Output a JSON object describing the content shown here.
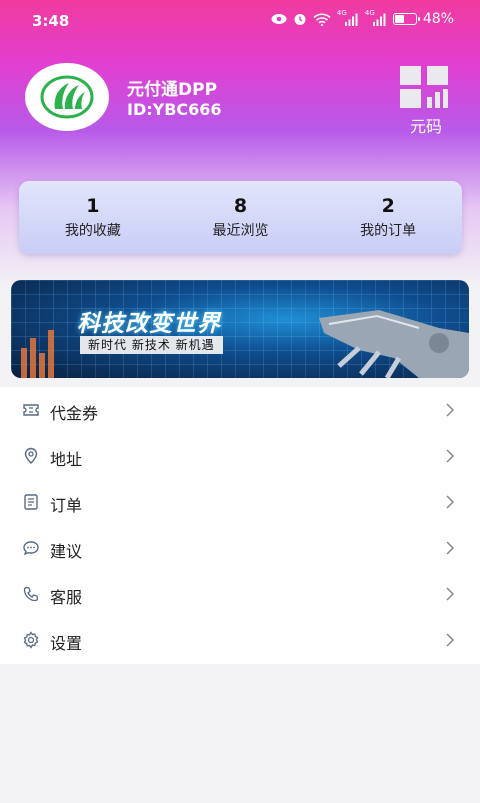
{
  "status_bar": {
    "time": "3:48",
    "battery": "48%",
    "battery_level": 0.48,
    "network_label_1": "4G",
    "network_label_2": "4G"
  },
  "profile": {
    "name": "元付通DPP",
    "id": "ID:YBC666",
    "qr_label": "元码"
  },
  "stats": [
    {
      "value": "1",
      "label": "我的收藏"
    },
    {
      "value": "8",
      "label": "最近浏览"
    },
    {
      "value": "2",
      "label": "我的订单"
    }
  ],
  "banner": {
    "title": "科技改变世界",
    "subtitle": "新时代 新技术 新机遇"
  },
  "menu": [
    {
      "label": "代金券",
      "icon": "coupon-icon"
    },
    {
      "label": "地址",
      "icon": "location-icon"
    },
    {
      "label": "订单",
      "icon": "order-list-icon"
    },
    {
      "label": "建议",
      "icon": "chat-bubble-icon"
    },
    {
      "label": "客服",
      "icon": "phone-icon"
    },
    {
      "label": "设置",
      "icon": "gear-icon"
    }
  ],
  "colors": {
    "header_top": "#f03a9e",
    "header_mid": "#b75ae9",
    "card_bg": "#c9cdf6",
    "icon_color": "#5a6a86",
    "logo_green": "#2bb24c"
  }
}
